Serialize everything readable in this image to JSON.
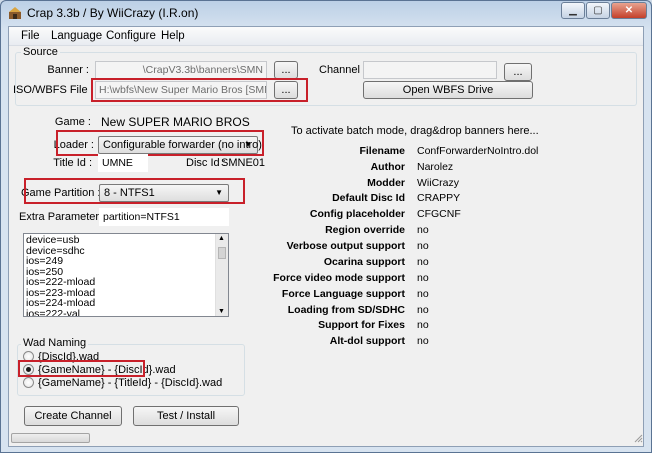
{
  "window": {
    "title": "Crap 3.3b / By WiiCrazy (I.R.on)"
  },
  "menu": [
    "File",
    "Language",
    "Configure",
    "Help"
  ],
  "source": {
    "group_label": "Source",
    "banner_label": "Banner :",
    "banner_value": "\\CrapV3.3b\\banners\\SMN",
    "browse_label": "...",
    "channel_label": "Channel :",
    "channel_value": "",
    "iso_label": "ISO/WBFS File :",
    "iso_value": "H:\\wbfs\\New Super Mario Bros [SMNE01]\\SI",
    "open_wbfs_label": "Open WBFS Drive"
  },
  "game": {
    "game_label": "Game :",
    "game_name": "New SUPER MARIO BROS",
    "loader_label": "Loader :",
    "loader_value": "Configurable forwarder (no intro)",
    "title_id_label": "Title Id :",
    "title_id_value": "UMNE",
    "disc_id_label": "Disc Id :",
    "disc_id_value": "SMNE01",
    "partition_label": "Game Partition :",
    "partition_value": "8 - NTFS1",
    "extra_label": "Extra Parameters :",
    "extra_value": "partition=NTFS1"
  },
  "params_list": [
    "device=usb",
    "device=sdhc",
    "ios=249",
    "ios=250",
    "ios=222-mload",
    "ios=223-mload",
    "ios=224-mload",
    "ios=222-yal"
  ],
  "wad_naming": {
    "group_label": "Wad Naming",
    "options": [
      "{DiscId}.wad",
      "{GameName} - {DiscId}.wad",
      "{GameName} - {TitleId} - {DiscId}.wad"
    ],
    "selected_index": 1
  },
  "actions": {
    "create_channel": "Create Channel",
    "test_install": "Test / Install"
  },
  "batch_hint": "To activate batch mode, drag&drop banners here...",
  "info": [
    {
      "label": "Filename",
      "value": "ConfForwarderNoIntro.dol"
    },
    {
      "label": "Author",
      "value": "Narolez"
    },
    {
      "label": "Modder",
      "value": "WiiCrazy"
    },
    {
      "label": "Default Disc Id",
      "value": "CRAPPY"
    },
    {
      "label": "Config placeholder",
      "value": "CFGCNF"
    },
    {
      "label": "Region override",
      "value": "no"
    },
    {
      "label": "Verbose output support",
      "value": "no"
    },
    {
      "label": "Ocarina support",
      "value": "no"
    },
    {
      "label": "Force video mode support",
      "value": "no"
    },
    {
      "label": "Force Language support",
      "value": "no"
    },
    {
      "label": "Loading from SD/SDHC",
      "value": "no"
    },
    {
      "label": "Support for Fixes",
      "value": "no"
    },
    {
      "label": "Alt-dol support",
      "value": "no"
    }
  ],
  "colors": {
    "highlight_box": "#c8202a",
    "window_frame": "#bcd0e6"
  }
}
